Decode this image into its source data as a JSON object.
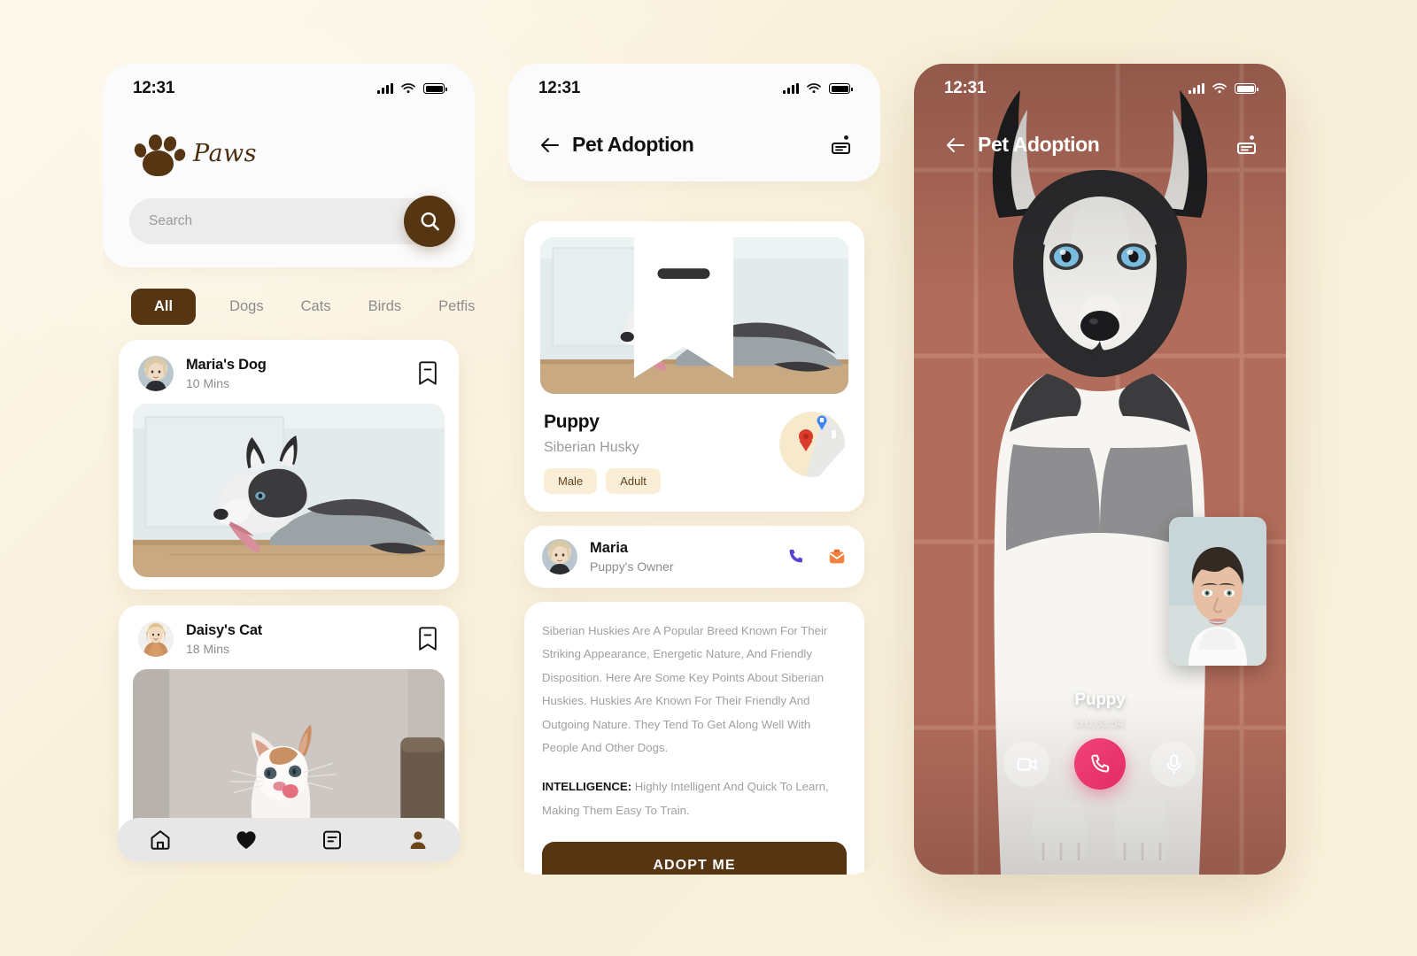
{
  "app": {
    "brand_name": "Paws",
    "accent_brown": "#563512",
    "bg_cream": "#FAF3E3",
    "end_call_pink": "#E32C63"
  },
  "phone1": {
    "status": {
      "time": "12:31",
      "signal": "signal-bars-icon",
      "wifi": "wifi-icon",
      "battery": "battery-full-icon"
    },
    "search": {
      "placeholder": "Search",
      "value": "",
      "button_icon": "search-icon"
    },
    "tabs": [
      {
        "label": "All",
        "active": true
      },
      {
        "label": "Dogs",
        "active": false
      },
      {
        "label": "Cats",
        "active": false
      },
      {
        "label": "Birds",
        "active": false
      },
      {
        "label": "Petfish",
        "active": false
      }
    ],
    "posts": [
      {
        "title": "Maria's Dog",
        "time": "10 Mins",
        "bookmark_icon": "bookmark-minus-icon",
        "photo": "husky-lying-down"
      },
      {
        "title": "Daisy's Cat",
        "time": "18 Mins",
        "bookmark_icon": "bookmark-minus-icon",
        "photo": "kitten-looking-up"
      }
    ],
    "bottom_nav": [
      {
        "name": "home",
        "icon": "home-icon",
        "active": false
      },
      {
        "name": "favorites",
        "icon": "heart-icon",
        "active": false
      },
      {
        "name": "messages",
        "icon": "message-icon",
        "active": false
      },
      {
        "name": "profile",
        "icon": "person-icon",
        "active": true
      }
    ]
  },
  "phone2": {
    "status": {
      "time": "12:31"
    },
    "header": {
      "back_icon": "arrow-left-icon",
      "title": "Pet Adoption",
      "action_icon": "id-card-icon"
    },
    "pet": {
      "photo": "husky-lying-down",
      "bookmark_icon": "bookmark-minus-icon",
      "name": "Puppy",
      "breed": "Siberian Husky",
      "chips": [
        "Male",
        "Adult"
      ],
      "map_icon": "map-pin-thumbnail"
    },
    "owner": {
      "name": "Maria",
      "role": "Puppy's Owner",
      "call_icon": "phone-icon",
      "mail_icon": "mail-icon"
    },
    "description": {
      "paragraph1": "Siberian Huskies Are A Popular Breed Known For Their Striking Appearance, Energetic Nature, And Friendly Disposition. Here Are Some Key Points About Siberian Huskies. Huskies Are Known For Their Friendly And Outgoing Nature. They Tend To Get Along Well With People And Other Dogs.",
      "label2": "INTELLIGENCE:",
      "paragraph2": " Highly Intelligent And Quick To Learn, Making Them Easy To Train."
    },
    "adopt_button": "ADOPT ME"
  },
  "phone3": {
    "status": {
      "time": "12:31"
    },
    "header": {
      "back_icon": "arrow-left-icon",
      "title": "Pet Adoption",
      "action_icon": "id-card-icon"
    },
    "background_photo": "husky-sitting-on-tiles",
    "pip_photo": "man-portrait",
    "call": {
      "name": "Puppy",
      "timer": "0.0.03.54",
      "controls": [
        {
          "name": "video",
          "icon": "video-camera-icon"
        },
        {
          "name": "end-call",
          "icon": "phone-icon"
        },
        {
          "name": "mute",
          "icon": "microphone-icon"
        }
      ]
    }
  }
}
